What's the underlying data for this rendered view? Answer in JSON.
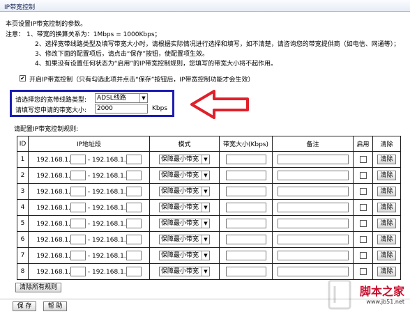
{
  "title": "IP带宽控制",
  "intro": "本页设置IP带宽控制的参数。",
  "notes": {
    "label": "注意：",
    "items": [
      "1、带宽的换算关系为：1Mbps = 1000Kbps；",
      "2、选择宽带线路类型及填写带宽大小时，请根据实际情况进行选择和填写，如不清楚，请咨询您的带宽提供商（如电信、网通等）；",
      "3、修改下面的配置项后，请点击“保存”按钮，使配置项生效。",
      "4、如果没有设置任何状态为“启用”的IP带宽控制规则，您填写的带宽大小将不起作用。"
    ]
  },
  "enable": {
    "checked": "✔",
    "label": "开启IP带宽控制（只有勾选此项并点击“保存”按钮后，IP带宽控制功能才会生效）"
  },
  "line": {
    "type_label": "请选择您的宽带线路类型:",
    "type_value": "ADSL线路",
    "bw_label": "请填写您申请的带宽大小:",
    "bw_value": "2000",
    "bw_unit": "Kbps"
  },
  "rules": {
    "label": "请配置IP带宽控制规则:",
    "headers": [
      "ID",
      "IP地址段",
      "模式",
      "带宽大小(Kbps)",
      "备注",
      "启用",
      "清除"
    ],
    "ip_prefix": "192.168.1.",
    "ip_sep": "-",
    "mode_value": "保障最小带宽",
    "clear_label": "清除",
    "ids": [
      "1",
      "2",
      "3",
      "4",
      "5",
      "6",
      "7",
      "8"
    ]
  },
  "clear_all_label": "清除所有规则",
  "save_label": "保 存",
  "help_label": "帮 助",
  "dropdown_arrow": "▼",
  "watermark": {
    "main": "脚本之家",
    "sub": "www.jb51.net"
  },
  "colors": {
    "highlight_box": "#1d1db3",
    "arrow": "#e0202a",
    "watermark": "#c8102e"
  }
}
